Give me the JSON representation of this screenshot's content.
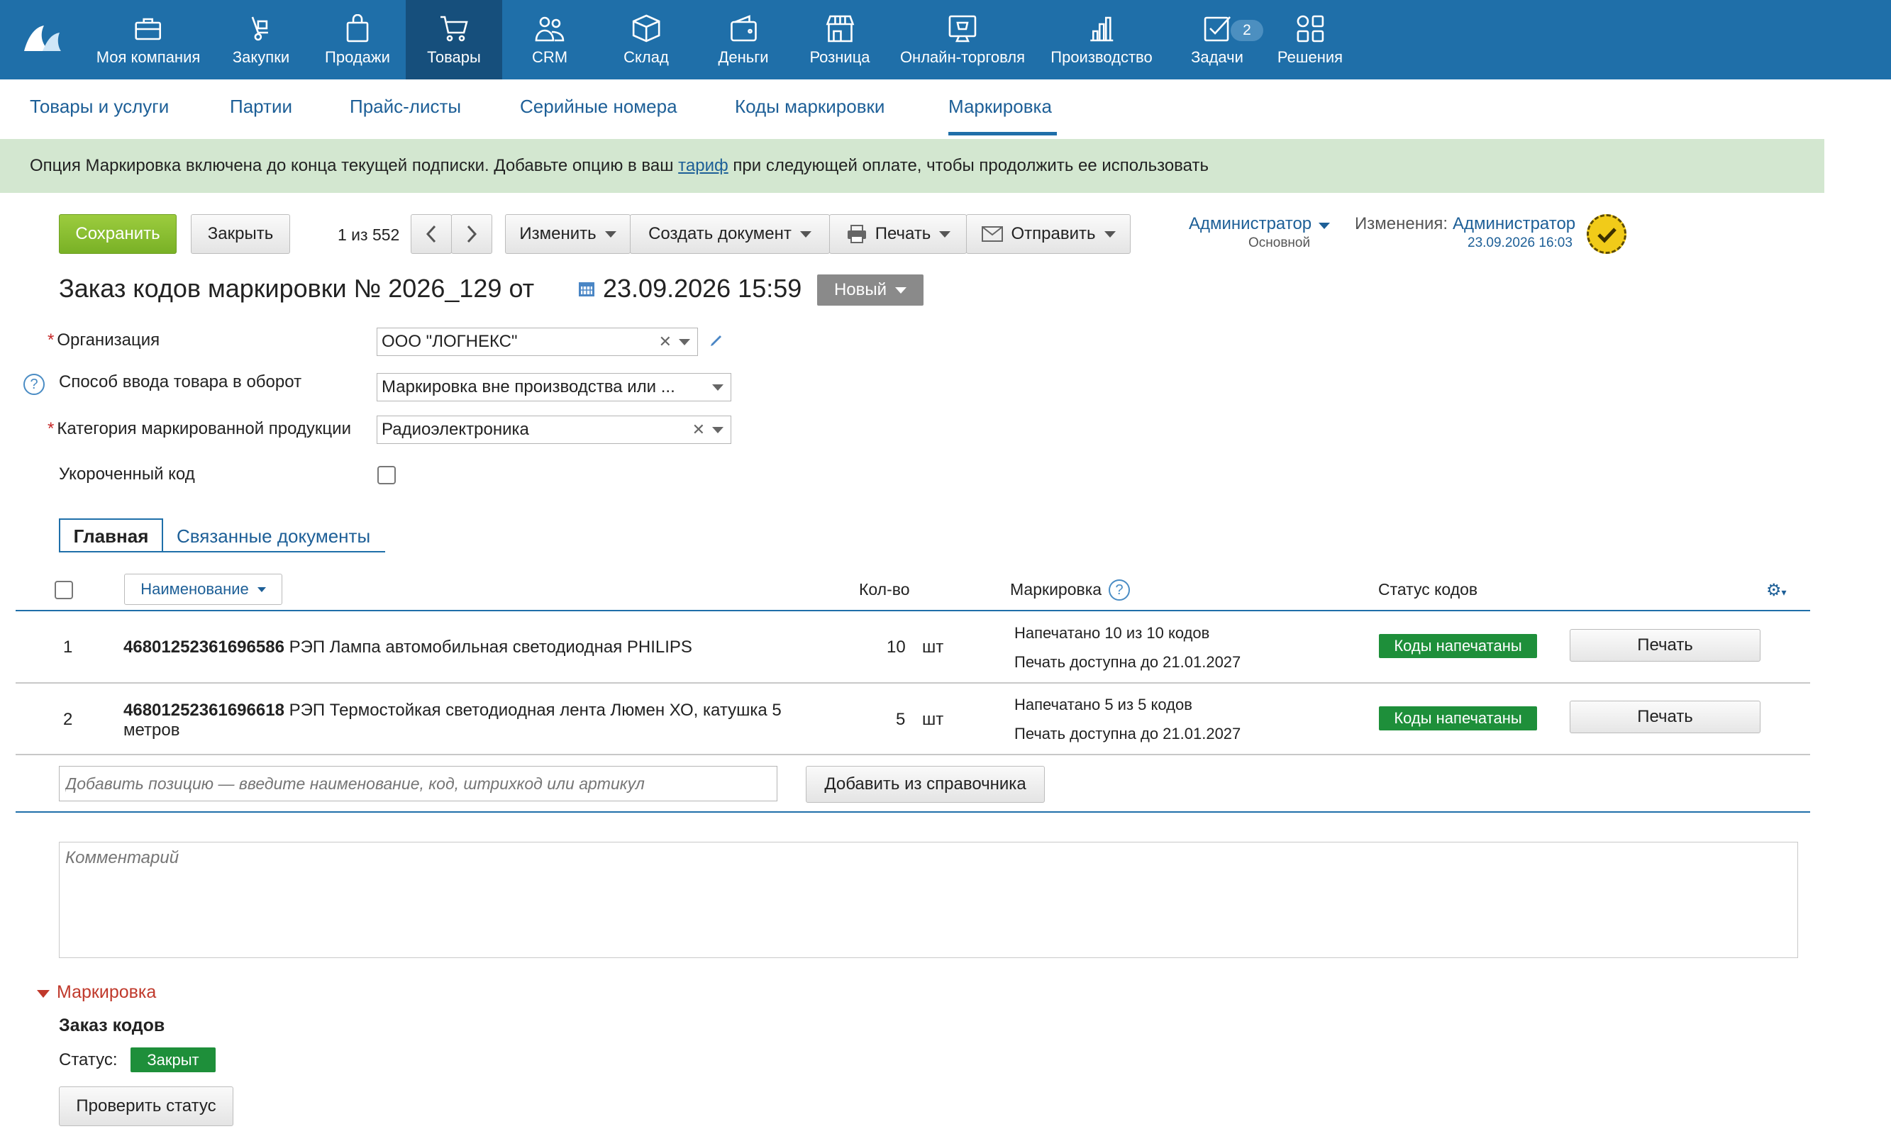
{
  "nav": [
    {
      "label": "Моя компания",
      "icon": "briefcase-icon"
    },
    {
      "label": "Закупки",
      "icon": "handcart-icon"
    },
    {
      "label": "Продажи",
      "icon": "shopping-bag-icon"
    },
    {
      "label": "Товары",
      "icon": "cart-icon"
    },
    {
      "label": "CRM",
      "icon": "people-icon"
    },
    {
      "label": "Склад",
      "icon": "box-icon"
    },
    {
      "label": "Деньги",
      "icon": "wallet-icon"
    },
    {
      "label": "Розница",
      "icon": "store-icon"
    },
    {
      "label": "Онлайн-торговля",
      "icon": "online-store-icon"
    },
    {
      "label": "Производство",
      "icon": "bar-chart-icon"
    },
    {
      "label": "Задачи",
      "icon": "checkbox-icon"
    },
    {
      "label": "Решения",
      "icon": "apps-grid-icon"
    }
  ],
  "tasks_badge": "2",
  "tabs": [
    "Товары и услуги",
    "Партии",
    "Прайс-листы",
    "Серийные номера",
    "Коды маркировки",
    "Маркировка"
  ],
  "notice": {
    "before": "Опция Маркировка включена до конца текущей подписки. Добавьте опцию в ваш ",
    "link": "тариф",
    "after": " при следующей оплате, чтобы продолжить ее использовать"
  },
  "toolbar": {
    "save": "Сохранить",
    "close": "Закрыть",
    "pager": "1 из 552",
    "edit": "Изменить",
    "create_doc": "Создать документ",
    "print": "Печать",
    "send": "Отправить"
  },
  "owner": {
    "name": "Администратор",
    "sub": "Основной",
    "changes_label": "Изменения:",
    "changes_user": "Администратор",
    "changes_date": "23.09.2026 16:03"
  },
  "doc": {
    "title": "Заказ кодов маркировки №  2026_129   от",
    "date": "23.09.2026 15:59",
    "state": "Новый"
  },
  "form": {
    "org_label": "Организация",
    "org_value": "ООО \"ЛОГНЕКС\"",
    "method_label": "Способ ввода товара в оборот",
    "method_value": "Маркировка вне производства или ...",
    "category_label": "Категория маркированной продукции",
    "category_value": "Радиоэлектроника",
    "short_label": "Укороченный код",
    "short_checked": false
  },
  "subtabs": {
    "main": "Главная",
    "related": "Связанные документы"
  },
  "table": {
    "headers": {
      "name": "Наименование",
      "qty": "Кол-во",
      "marking": "Маркировка",
      "status": "Статус кодов"
    },
    "rows": [
      {
        "n": "1",
        "code": "46801252361696586",
        "name": " РЭП Лампа автомобильная светодиодная PHILIPS",
        "name2": "",
        "qty": "10",
        "unit": "шт",
        "mk1": "Напечатано 10 из 10 кодов",
        "mk2": "Печать доступна до 21.01.2027",
        "status": "Коды напечатаны",
        "btn": "Печать"
      },
      {
        "n": "2",
        "code": "46801252361696618",
        "name": " РЭП Термостойкая светодиодная лента Люмен ХО, катушка 5",
        "name2": "метров",
        "qty": "5",
        "unit": "шт",
        "mk1": "Напечатано 5 из 5 кодов",
        "mk2": "Печать доступна до 21.01.2027",
        "status": "Коды напечатаны",
        "btn": "Печать"
      }
    ]
  },
  "add_position_placeholder": "Добавить позицию — введите наименование, код, штрихкод или артикул",
  "add_from_ref": "Добавить из справочника",
  "comment_placeholder": "Комментарий",
  "marking_section": {
    "toggle": "Маркировка",
    "heading": "Заказ кодов",
    "status_label": "Статус:",
    "status_value": "Закрыт",
    "check_button": "Проверить статус"
  },
  "colors": {
    "topbar": "#1f6fa9",
    "active_nav": "#164f7c",
    "notice_bg": "#d3e7d0",
    "save_green": "#79b126",
    "status_green": "#1e8f3a"
  }
}
